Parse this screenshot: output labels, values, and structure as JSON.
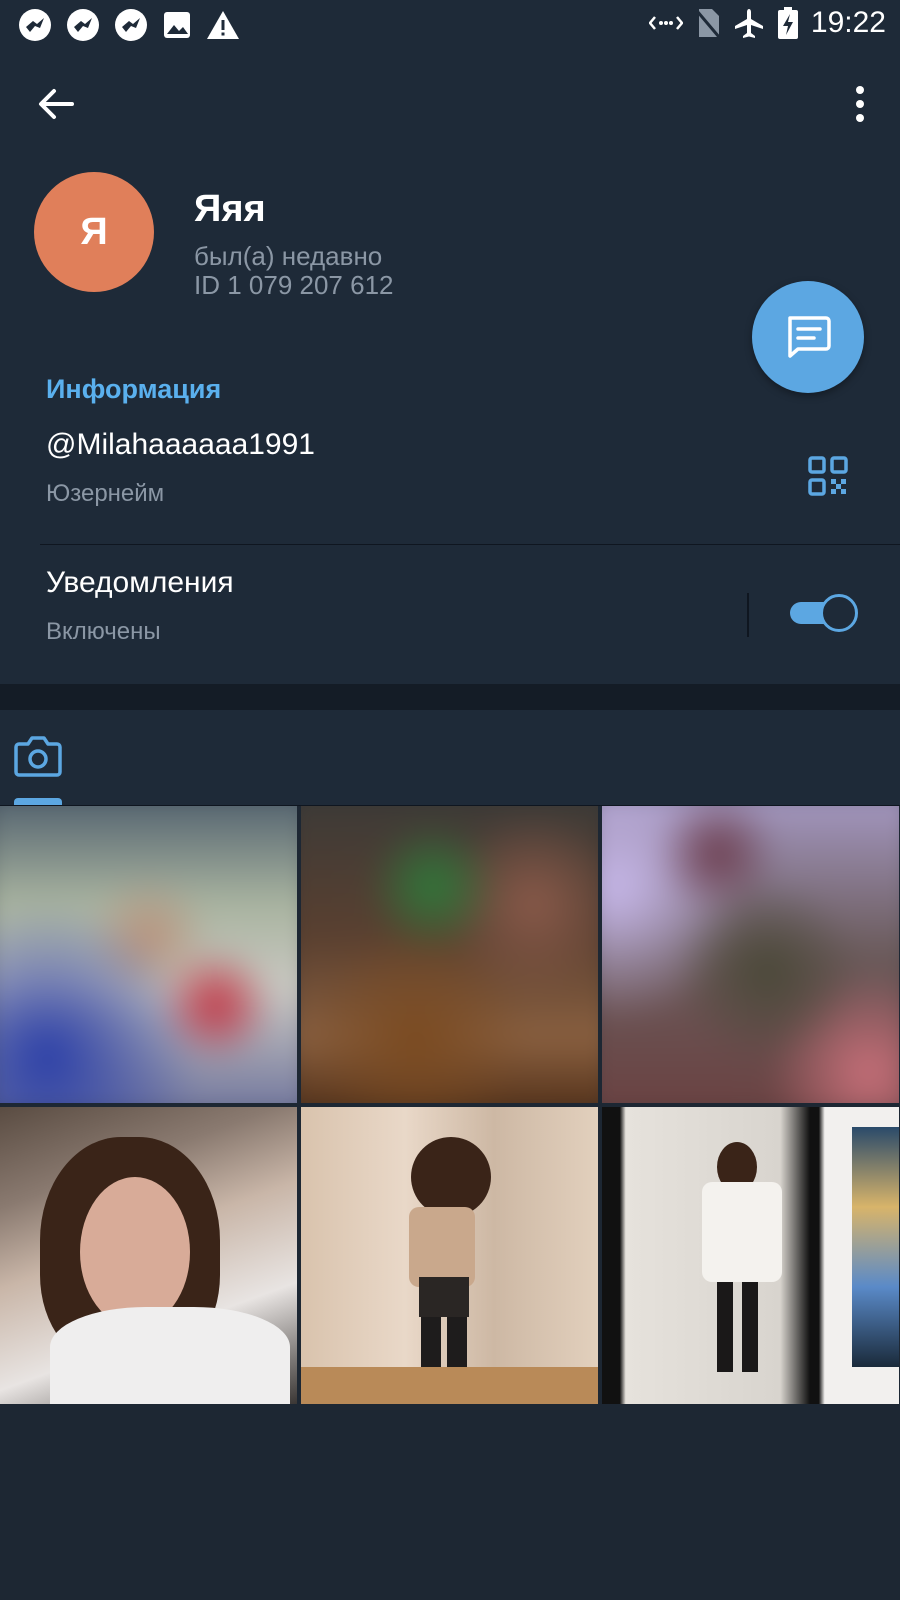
{
  "status_bar": {
    "time": "19:22",
    "left_icons": [
      "bird-notification-icon",
      "bird-notification-icon",
      "bird-notification-icon",
      "image-icon",
      "warning-icon"
    ],
    "right_icons": [
      "data-transfer-icon",
      "no-sim-icon",
      "airplane-mode-icon",
      "battery-charging-icon"
    ]
  },
  "header": {
    "avatar_letter": "Я",
    "name": "Яяя",
    "last_seen": "был(а) недавно",
    "user_id": "ID 1 079 207 612"
  },
  "info": {
    "section_title": "Информация",
    "username": "@Milahaaaaaa1991",
    "username_label": "Юзернейм",
    "notifications_title": "Уведомления",
    "notifications_state": "Включены",
    "notifications_enabled": true
  },
  "media": {
    "tabs": [
      {
        "icon": "camera-icon",
        "active": true
      }
    ],
    "photos_count": 6
  },
  "colors": {
    "accent": "#5ca7e2",
    "avatar": "#e07f5a",
    "section_title": "#5ab0ee",
    "background": "#1d2733",
    "panel": "#1e2a38",
    "secondary_text": "#8b97a5"
  }
}
